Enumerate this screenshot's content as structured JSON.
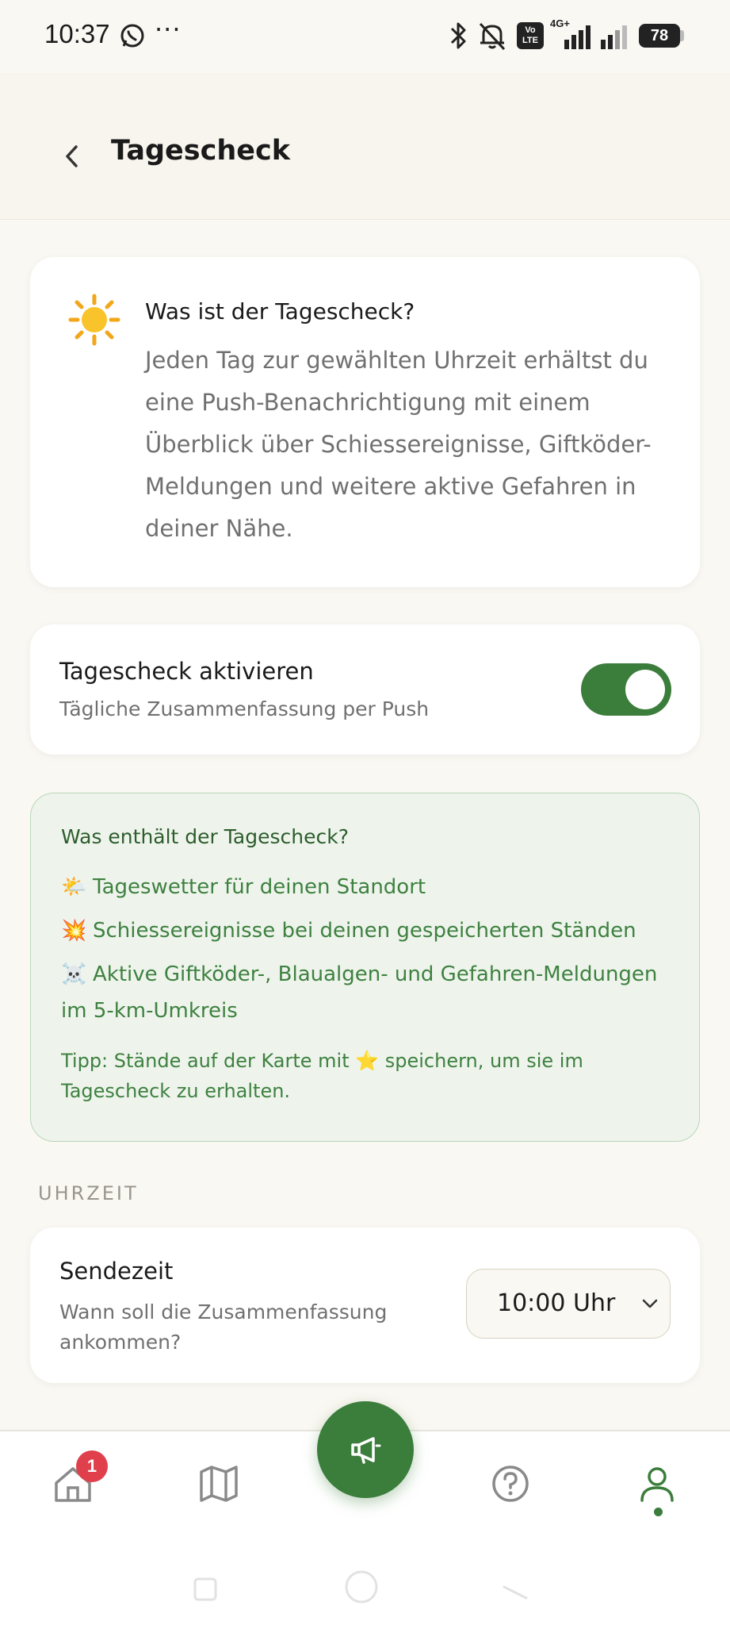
{
  "status_bar": {
    "time": "10:37",
    "more": "···",
    "volte": "Vo LTE",
    "network": "4G+",
    "battery": "78",
    "icons": [
      "whatsapp-icon",
      "bluetooth-icon",
      "mute-icon",
      "signal-icon",
      "signal-icon"
    ]
  },
  "header": {
    "title": "Tagescheck",
    "back_icon": "chevron-left-icon"
  },
  "info_card": {
    "icon": "sun-icon",
    "title": "Was ist der Tagescheck?",
    "text": "Jeden Tag zur gewählten Uhrzeit erhältst du eine Push-Benachrichtigung mit einem Überblick über Schiessereignisse, Giftköder-Meldungen und weitere aktive Gefahren in deiner Nähe."
  },
  "toggle_card": {
    "title": "Tagescheck aktivieren",
    "subtitle": "Tägliche Zusammenfassung per Push",
    "enabled": true
  },
  "contents": {
    "title": "Was enthält der Tagescheck?",
    "items": [
      {
        "emoji": "🌤️",
        "text": "Tageswetter für deinen Standort"
      },
      {
        "emoji": "💥",
        "text": "Schiessereignisse bei deinen gespeicherten Ständen"
      },
      {
        "emoji": "☠️",
        "text": "Aktive Giftköder-, Blaualgen- und Gefahren-Meldungen im 5-km-Umkreis"
      }
    ],
    "tip": "Tipp: Stände auf der Karte mit ⭐ speichern, um sie im Tagescheck zu erhalten."
  },
  "time_section": {
    "label": "UHRZEIT",
    "title": "Sendezeit",
    "subtitle": "Wann soll die Zusammenfassung ankommen?",
    "selected": "10:00 Uhr"
  },
  "bottom_nav": {
    "home_badge": "1",
    "items": [
      "home-icon",
      "map-icon",
      "megaphone-icon",
      "help-icon",
      "profile-icon"
    ],
    "active": "profile"
  },
  "colors": {
    "accent": "#3b7d3b",
    "badge": "#e0404c",
    "background": "#faf8f3",
    "info_box": "#eef4ec"
  }
}
